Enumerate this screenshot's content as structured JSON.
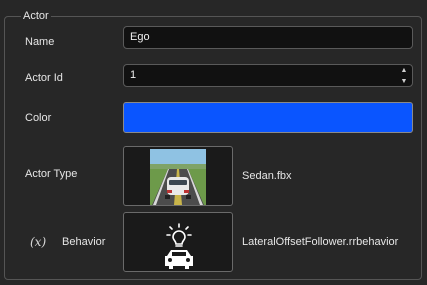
{
  "group": {
    "title": "Actor"
  },
  "fields": {
    "name": {
      "label": "Name",
      "value": "Ego"
    },
    "actor_id": {
      "label": "Actor Id",
      "value": "1"
    },
    "color": {
      "label": "Color",
      "value": "#0a55ff"
    },
    "actor_type": {
      "label": "Actor Type",
      "asset": "Sedan.fbx"
    },
    "behavior": {
      "variable_icon": "(x)",
      "label": "Behavior",
      "asset": "LateralOffsetFollower.rrbehavior"
    }
  },
  "icons": {
    "variable": "variable-icon",
    "spin_up": "chevron-up-icon",
    "spin_down": "chevron-down-icon",
    "behavior": "car-lightbulb-icon"
  }
}
